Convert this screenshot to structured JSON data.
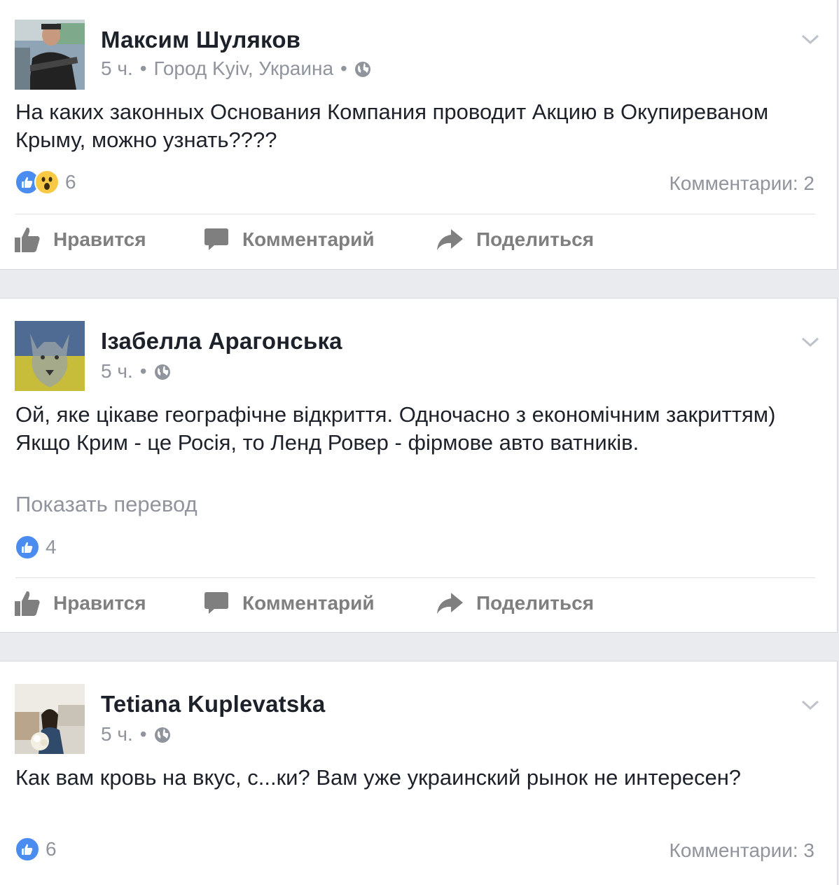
{
  "posts": [
    {
      "author": "Максим Шуляков",
      "time": "5 ч.",
      "sep1": "•",
      "location": "Город Kyiv, Украина",
      "sep2": "•",
      "text": "На каких законных Основания Компания проводит Акцию в Окупиреваном Крыму, можно узнать????",
      "reactions_count": "6",
      "comments": "Комментарии: 2"
    },
    {
      "author": "Ізабелла Арагонська",
      "time": "5 ч.",
      "sep1": "•",
      "text": "Ой, яке цікаве географічне відкриття. Одночасно з економічним закриттям) Якщо Крим - це Росія, то Ленд Ровер - фірмове авто ватників.",
      "translate": "Показать перевод",
      "reactions_count": "4"
    },
    {
      "author": "Tetiana Kuplevatska",
      "time": "5 ч.",
      "sep1": "•",
      "text": "Как вам кровь на вкус, с...ки? Вам уже украинский рынок не интересен?",
      "reactions_count": "6",
      "comments": "Комментарии: 3"
    }
  ],
  "actions": {
    "like": "Нравится",
    "comment": "Комментарий",
    "share": "Поделиться"
  },
  "icons": {
    "like": "thumbs-up-icon",
    "comment": "speech-bubble-icon",
    "share": "share-arrow-icon",
    "privacy": "globe-icon",
    "menu": "chevron-down-icon",
    "wow": "wow-reaction-icon"
  },
  "colors": {
    "like_blue": "#4a8cf0",
    "wow_yellow": "#f7c945",
    "muted": "#90949c",
    "action_gray": "#7f7f7f",
    "background": "#e9ebee"
  }
}
